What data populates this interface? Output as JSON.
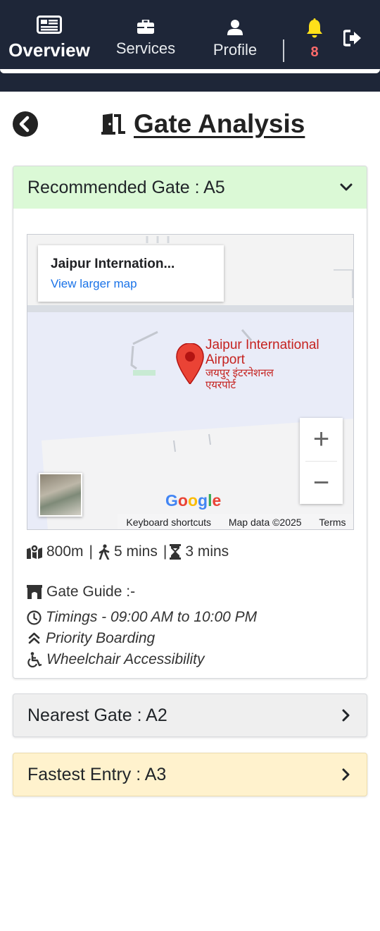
{
  "nav": {
    "overview": "Overview",
    "services": "Services",
    "profile": "Profile",
    "notification_count": "8",
    "icons": [
      "overview-icon",
      "briefcase-icon",
      "user-icon",
      "bell-icon",
      "logout-icon"
    ]
  },
  "page": {
    "title": "Gate Analysis"
  },
  "recommended": {
    "title": "Recommended Gate : A5",
    "map": {
      "place_name": "Jaipur Internation...",
      "larger_map_link": "View larger map",
      "label_en_line1": "Jaipur International",
      "label_en_line2": "Airport",
      "label_hi_line1": "जयपुर इंटरनेशनल",
      "label_hi_line2": "एयरपोर्ट",
      "zoom_in": "+",
      "zoom_out": "−",
      "google_logo": "Google",
      "footer": {
        "shortcuts": "Keyboard shortcuts",
        "map_data": "Map data ©2025",
        "terms": "Terms"
      }
    },
    "stats": {
      "distance": "800m",
      "walk_time": "5 mins",
      "wait_time": "3 mins",
      "separator": "|"
    },
    "guide": {
      "title": "Gate Guide :-",
      "timings": "Timings - 09:00 AM to 10:00 PM",
      "priority": "Priority Boarding",
      "wheelchair": "Wheelchair Accessibility"
    }
  },
  "nearest": {
    "title": "Nearest Gate : A2"
  },
  "fastest": {
    "title": "Fastest Entry : A3"
  },
  "colors": {
    "navbar": "#1e2638",
    "recommended_header": "#dbf9d6",
    "nearest_bg": "#efefef",
    "fastest_bg": "#fff2cd",
    "bell": "#ffe01a",
    "notification": "#ff6b6b",
    "map_pin": "#ea4335"
  }
}
